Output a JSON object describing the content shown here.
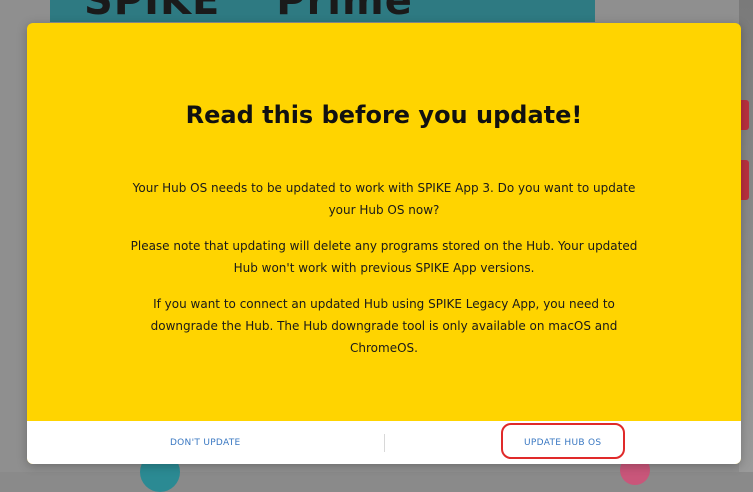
{
  "background": {
    "banner_title": "SPIKE™ Prime"
  },
  "dialog": {
    "title": "Read this before you update!",
    "paragraphs": [
      "Your Hub OS needs to be updated to work with SPIKE App 3. Do you want to update your Hub OS now?",
      "Please note that updating will delete any programs stored on the Hub. Your updated Hub won't work with previous SPIKE App versions.",
      "If you want to connect an updated Hub using SPIKE Legacy App, you need to downgrade the Hub. The Hub downgrade tool is only available on macOS and ChromeOS."
    ],
    "buttons": {
      "dont_update": "DON'T UPDATE",
      "update_hub_os": "UPDATE HUB OS"
    }
  },
  "colors": {
    "dialog_background": "#ffd400",
    "footer_background": "#ffffff",
    "button_text": "#3a78c2",
    "highlight_ring": "#e02a2a"
  }
}
